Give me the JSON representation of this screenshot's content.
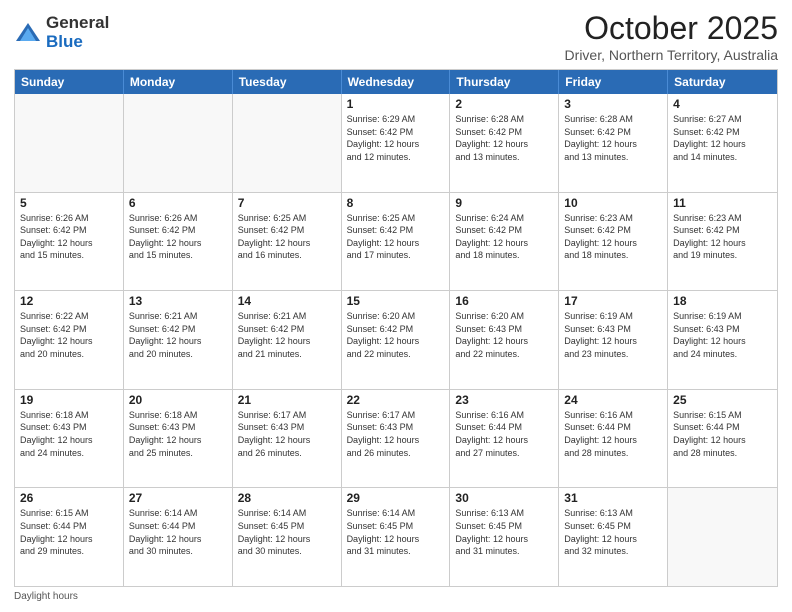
{
  "logo": {
    "general": "General",
    "blue": "Blue"
  },
  "header": {
    "month": "October 2025",
    "location": "Driver, Northern Territory, Australia"
  },
  "weekdays": [
    "Sunday",
    "Monday",
    "Tuesday",
    "Wednesday",
    "Thursday",
    "Friday",
    "Saturday"
  ],
  "rows": [
    [
      {
        "day": "",
        "info": ""
      },
      {
        "day": "",
        "info": ""
      },
      {
        "day": "",
        "info": ""
      },
      {
        "day": "1",
        "info": "Sunrise: 6:29 AM\nSunset: 6:42 PM\nDaylight: 12 hours\nand 12 minutes."
      },
      {
        "day": "2",
        "info": "Sunrise: 6:28 AM\nSunset: 6:42 PM\nDaylight: 12 hours\nand 13 minutes."
      },
      {
        "day": "3",
        "info": "Sunrise: 6:28 AM\nSunset: 6:42 PM\nDaylight: 12 hours\nand 13 minutes."
      },
      {
        "day": "4",
        "info": "Sunrise: 6:27 AM\nSunset: 6:42 PM\nDaylight: 12 hours\nand 14 minutes."
      }
    ],
    [
      {
        "day": "5",
        "info": "Sunrise: 6:26 AM\nSunset: 6:42 PM\nDaylight: 12 hours\nand 15 minutes."
      },
      {
        "day": "6",
        "info": "Sunrise: 6:26 AM\nSunset: 6:42 PM\nDaylight: 12 hours\nand 15 minutes."
      },
      {
        "day": "7",
        "info": "Sunrise: 6:25 AM\nSunset: 6:42 PM\nDaylight: 12 hours\nand 16 minutes."
      },
      {
        "day": "8",
        "info": "Sunrise: 6:25 AM\nSunset: 6:42 PM\nDaylight: 12 hours\nand 17 minutes."
      },
      {
        "day": "9",
        "info": "Sunrise: 6:24 AM\nSunset: 6:42 PM\nDaylight: 12 hours\nand 18 minutes."
      },
      {
        "day": "10",
        "info": "Sunrise: 6:23 AM\nSunset: 6:42 PM\nDaylight: 12 hours\nand 18 minutes."
      },
      {
        "day": "11",
        "info": "Sunrise: 6:23 AM\nSunset: 6:42 PM\nDaylight: 12 hours\nand 19 minutes."
      }
    ],
    [
      {
        "day": "12",
        "info": "Sunrise: 6:22 AM\nSunset: 6:42 PM\nDaylight: 12 hours\nand 20 minutes."
      },
      {
        "day": "13",
        "info": "Sunrise: 6:21 AM\nSunset: 6:42 PM\nDaylight: 12 hours\nand 20 minutes."
      },
      {
        "day": "14",
        "info": "Sunrise: 6:21 AM\nSunset: 6:42 PM\nDaylight: 12 hours\nand 21 minutes."
      },
      {
        "day": "15",
        "info": "Sunrise: 6:20 AM\nSunset: 6:42 PM\nDaylight: 12 hours\nand 22 minutes."
      },
      {
        "day": "16",
        "info": "Sunrise: 6:20 AM\nSunset: 6:43 PM\nDaylight: 12 hours\nand 22 minutes."
      },
      {
        "day": "17",
        "info": "Sunrise: 6:19 AM\nSunset: 6:43 PM\nDaylight: 12 hours\nand 23 minutes."
      },
      {
        "day": "18",
        "info": "Sunrise: 6:19 AM\nSunset: 6:43 PM\nDaylight: 12 hours\nand 24 minutes."
      }
    ],
    [
      {
        "day": "19",
        "info": "Sunrise: 6:18 AM\nSunset: 6:43 PM\nDaylight: 12 hours\nand 24 minutes."
      },
      {
        "day": "20",
        "info": "Sunrise: 6:18 AM\nSunset: 6:43 PM\nDaylight: 12 hours\nand 25 minutes."
      },
      {
        "day": "21",
        "info": "Sunrise: 6:17 AM\nSunset: 6:43 PM\nDaylight: 12 hours\nand 26 minutes."
      },
      {
        "day": "22",
        "info": "Sunrise: 6:17 AM\nSunset: 6:43 PM\nDaylight: 12 hours\nand 26 minutes."
      },
      {
        "day": "23",
        "info": "Sunrise: 6:16 AM\nSunset: 6:44 PM\nDaylight: 12 hours\nand 27 minutes."
      },
      {
        "day": "24",
        "info": "Sunrise: 6:16 AM\nSunset: 6:44 PM\nDaylight: 12 hours\nand 28 minutes."
      },
      {
        "day": "25",
        "info": "Sunrise: 6:15 AM\nSunset: 6:44 PM\nDaylight: 12 hours\nand 28 minutes."
      }
    ],
    [
      {
        "day": "26",
        "info": "Sunrise: 6:15 AM\nSunset: 6:44 PM\nDaylight: 12 hours\nand 29 minutes."
      },
      {
        "day": "27",
        "info": "Sunrise: 6:14 AM\nSunset: 6:44 PM\nDaylight: 12 hours\nand 30 minutes."
      },
      {
        "day": "28",
        "info": "Sunrise: 6:14 AM\nSunset: 6:45 PM\nDaylight: 12 hours\nand 30 minutes."
      },
      {
        "day": "29",
        "info": "Sunrise: 6:14 AM\nSunset: 6:45 PM\nDaylight: 12 hours\nand 31 minutes."
      },
      {
        "day": "30",
        "info": "Sunrise: 6:13 AM\nSunset: 6:45 PM\nDaylight: 12 hours\nand 31 minutes."
      },
      {
        "day": "31",
        "info": "Sunrise: 6:13 AM\nSunset: 6:45 PM\nDaylight: 12 hours\nand 32 minutes."
      },
      {
        "day": "",
        "info": ""
      }
    ]
  ],
  "footer": {
    "daylight_label": "Daylight hours"
  }
}
